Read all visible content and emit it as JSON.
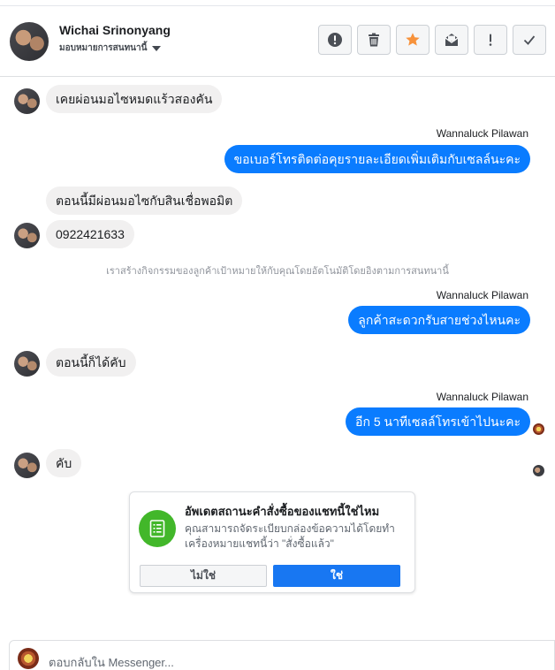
{
  "header": {
    "name": "Wichai Srinonyang",
    "status": "มอบหมายการสนทนานี้",
    "actions": [
      {
        "name": "spam-icon"
      },
      {
        "name": "trash-icon"
      },
      {
        "name": "star-icon"
      },
      {
        "name": "mark-unread-icon"
      },
      {
        "name": "exclamation-icon"
      },
      {
        "name": "checkmark-icon"
      }
    ]
  },
  "messages": {
    "m1": "เคยผ่อนมอไซหมดแร้วสองคัน",
    "sender1": "Wannaluck Pilawan",
    "m2": "ขอเบอร์โทรติดต่อคุยรายละเอียดเพิ่มเติมกับเซลล์นะคะ",
    "m3": "ตอนนี้มีผ่อนมอไซกับสินเชื่อพอมิต",
    "m4": "0922421633",
    "system": "เราสร้างกิจกรรมของลูกค้าเป้าหมายให้กับคุณโดยอัตโนมัติโดยอิงตามการสนทนานี้",
    "sender2": "Wannaluck Pilawan",
    "m5": "ลูกค้าสะดวกรับสายช่วงไหนคะ",
    "m6": "ตอนนี้ก็ได้คับ",
    "sender3": "Wannaluck Pilawan",
    "m7": "อีก 5 นาทีเซลล์โทรเข้าไปนะคะ",
    "m8": "คับ"
  },
  "prompt": {
    "title": "อัพเดตสถานะคำสั่งซื้อของแชทนี้ใช่ไหม",
    "body": "คุณสามารถจัดระเบียบกล่องข้อความได้โดยทำเครื่องหมายแชทนี้ว่า \"สั่งซื้อแล้ว\"",
    "no_label": "ไม่ใช่",
    "yes_label": "ใช่"
  },
  "composer": {
    "placeholder": "ตอบกลับใน Messenger..."
  },
  "colors": {
    "outgoing_bubble": "#0a7cff",
    "incoming_bubble": "#f1f0f0",
    "primary_button": "#1877f2",
    "prompt_icon_bg": "#42b72a",
    "star": "#f7923b"
  }
}
